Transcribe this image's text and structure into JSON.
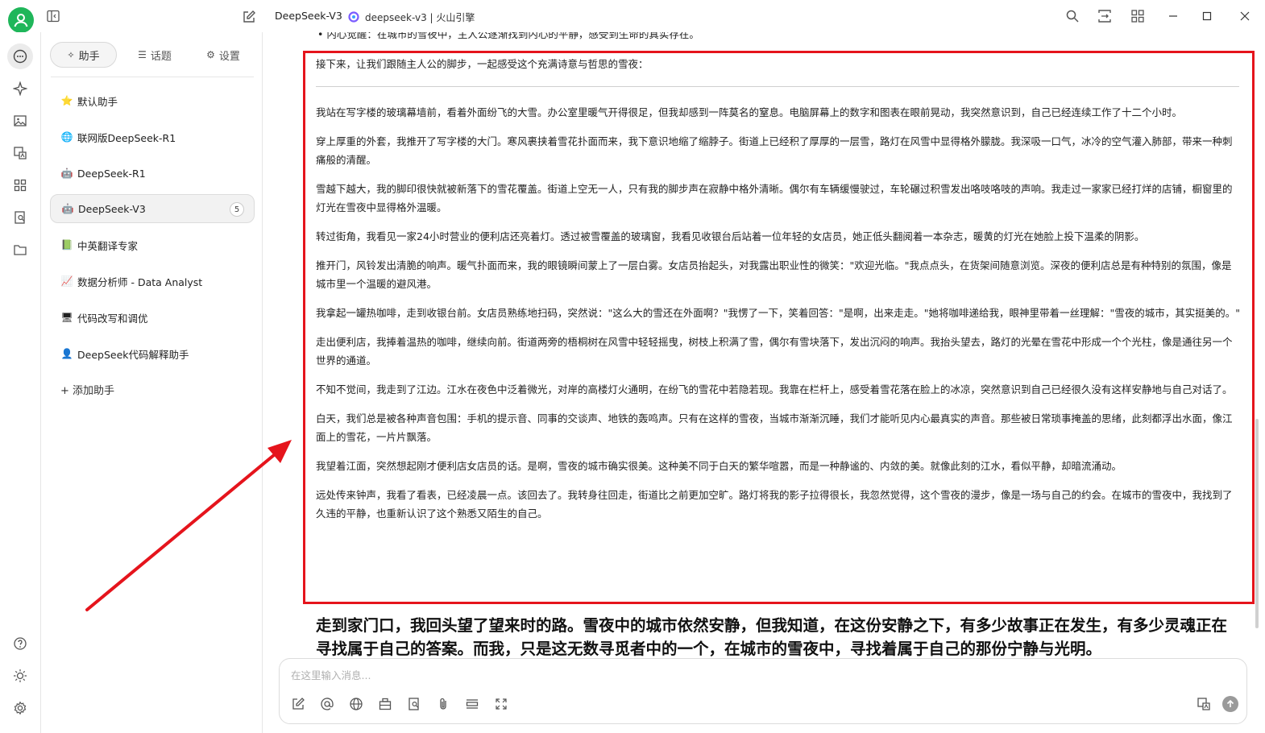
{
  "titlebar": {
    "model_name": "DeepSeek-V3",
    "provider_label": "deepseek-v3 | 火山引擎",
    "icons": [
      "search-icon",
      "fit-width-icon",
      "grid-icon",
      "minimize-icon",
      "maximize-icon",
      "close-icon"
    ]
  },
  "rail": {
    "icons": [
      "chat-icon",
      "sparkle-icon",
      "image-icon",
      "translate-icon",
      "apps-icon",
      "knowledge-icon",
      "folder-icon",
      "help-icon",
      "theme-icon",
      "settings-icon"
    ]
  },
  "panel": {
    "tabs": [
      {
        "label": "助手",
        "icon": "sparkle-icon"
      },
      {
        "label": "话题",
        "icon": "list-icon"
      },
      {
        "label": "设置",
        "icon": "gear-icon"
      }
    ],
    "assistants": [
      {
        "emoji": "⭐",
        "label": "默认助手"
      },
      {
        "emoji": "🌐",
        "label": "联网版DeepSeek-R1"
      },
      {
        "emoji": "🤖",
        "label": "DeepSeek-R1"
      },
      {
        "emoji": "🤖",
        "label": "DeepSeek-V3",
        "count": "5"
      },
      {
        "emoji": "📗",
        "label": "中英翻译专家"
      },
      {
        "emoji": "📈",
        "label": "数据分析师 - Data Analyst"
      },
      {
        "emoji": "🖥",
        "label": "代码改写和调优"
      },
      {
        "emoji": "👤",
        "label": "DeepSeek代码解释助手"
      }
    ],
    "add_label": "添加助手"
  },
  "chat": {
    "cut_bullet": "• 内心觉醒：在城市的雪夜中，主人公逐渐找到内心的平静，感受到生命的真实存在。",
    "intro": "接下来，让我们跟随主人公的脚步，一起感受这个充满诗意与哲思的雪夜：",
    "paragraphs": [
      "我站在写字楼的玻璃幕墙前，看着外面纷飞的大雪。办公室里暖气开得很足，但我却感到一阵莫名的窒息。电脑屏幕上的数字和图表在眼前晃动，我突然意识到，自己已经连续工作了十二个小时。",
      "穿上厚重的外套，我推开了写字楼的大门。寒风裹挟着雪花扑面而来，我下意识地缩了缩脖子。街道上已经积了厚厚的一层雪，路灯在风雪中显得格外朦胧。我深吸一口气，冰冷的空气灌入肺部，带来一种刺痛般的清醒。",
      "雪越下越大，我的脚印很快就被新落下的雪花覆盖。街道上空无一人，只有我的脚步声在寂静中格外清晰。偶尔有车辆缓慢驶过，车轮碾过积雪发出咯吱咯吱的声响。我走过一家家已经打烊的店铺，橱窗里的灯光在雪夜中显得格外温暖。",
      "转过街角，我看见一家24小时营业的便利店还亮着灯。透过被雪覆盖的玻璃窗，我看见收银台后站着一位年轻的女店员，她正低头翻阅着一本杂志，暖黄的灯光在她脸上投下温柔的阴影。",
      "推开门，风铃发出清脆的响声。暖气扑面而来，我的眼镜瞬间蒙上了一层白雾。女店员抬起头，对我露出职业性的微笑：\"欢迎光临。\"我点点头，在货架间随意浏览。深夜的便利店总是有种特别的氛围，像是城市里一个温暖的避风港。",
      "我拿起一罐热咖啡，走到收银台前。女店员熟练地扫码，突然说：\"这么大的雪还在外面啊？\"我愣了一下，笑着回答：\"是啊，出来走走。\"她将咖啡递给我，眼神里带着一丝理解：\"雪夜的城市，其实挺美的。\"",
      "走出便利店，我捧着温热的咖啡，继续向前。街道两旁的梧桐树在风雪中轻轻摇曳，树枝上积满了雪，偶尔有雪块落下，发出沉闷的响声。我抬头望去，路灯的光晕在雪花中形成一个个光柱，像是通往另一个世界的通道。",
      "不知不觉间，我走到了江边。江水在夜色中泛着微光，对岸的高楼灯火通明，在纷飞的雪花中若隐若现。我靠在栏杆上，感受着雪花落在脸上的冰凉，突然意识到自己已经很久没有这样安静地与自己对话了。",
      "白天，我们总是被各种声音包围：手机的提示音、同事的交谈声、地铁的轰鸣声。只有在这样的雪夜，当城市渐渐沉睡，我们才能听见内心最真实的声音。那些被日常琐事掩盖的思绪，此刻都浮出水面，像江面上的雪花，一片片飘落。",
      "我望着江面，突然想起刚才便利店女店员的话。是啊，雪夜的城市确实很美。这种美不同于白天的繁华喧嚣，而是一种静谧的、内敛的美。就像此刻的江水，看似平静，却暗流涌动。",
      "远处传来钟声，我看了看表，已经凌晨一点。该回去了。我转身往回走，街道比之前更加空旷。路灯将我的影子拉得很长，我忽然觉得，这个雪夜的漫步，像是一场与自己的约会。在城市的雪夜中，我找到了久违的平静，也重新认识了这个熟悉又陌生的自己。"
    ],
    "bold_tail": "走到家门口，我回头望了望来时的路。雪夜中的城市依然安静，但我知道，在这份安静之下，有多少故事正在发生，有多少灵魂正在寻找属于自己的答案。而我，只是这无数寻觅者中的一个，在城市的雪夜中，寻找着属于自己的那份宁静与光明。"
  },
  "composer": {
    "placeholder": "在这里输入消息...",
    "tools": [
      "new-topic-icon",
      "mention-icon",
      "web-search-icon",
      "knowledge-base-icon",
      "quick-phrase-icon",
      "attachment-icon",
      "clear-icon",
      "expand-icon",
      "translate-icon"
    ]
  },
  "colors": {
    "accent": "#1fb65a",
    "highlight_border": "#e5141c",
    "arrow": "#e5141c"
  }
}
